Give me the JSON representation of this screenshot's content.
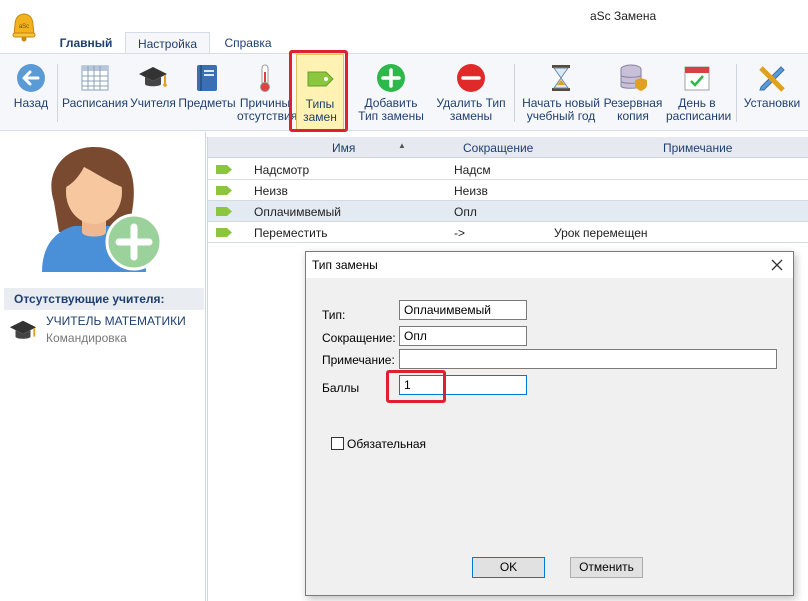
{
  "window": {
    "title": "aSc Замена"
  },
  "tabs": [
    {
      "label": "Главный"
    },
    {
      "label": "Настройка"
    },
    {
      "label": "Справка"
    }
  ],
  "toolbar": [
    {
      "label": "Назад",
      "icon": "back-arrow-icon"
    },
    {
      "label": "Расписания",
      "icon": "timetable-grid-icon"
    },
    {
      "label": "Учителя",
      "icon": "graduation-cap-icon"
    },
    {
      "label": "Предметы",
      "icon": "book-icon"
    },
    {
      "label": "Причины\nотсутствия",
      "icon": "thermometer-icon"
    },
    {
      "label": "Типы\nзамен",
      "icon": "tag-icon"
    },
    {
      "label": "Добавить\nТип замены",
      "icon": "plus-circle-icon"
    },
    {
      "label": "Удалить Тип\nзамены",
      "icon": "minus-circle-icon"
    },
    {
      "label": "Начать новый\nучебный год",
      "icon": "hourglass-icon"
    },
    {
      "label": "Резервная\nкопия",
      "icon": "database-shield-icon"
    },
    {
      "label": "День в\nрасписании",
      "icon": "calendar-check-icon"
    },
    {
      "label": "Установки",
      "icon": "pencil-ruler-icon"
    }
  ],
  "left_panel": {
    "absent_header": "Отсутствующие учителя:",
    "teachers": [
      {
        "name": "УЧИТЕЛЬ МАТЕМАТИКИ",
        "reason": "Командировка"
      }
    ]
  },
  "grid": {
    "columns": [
      "Имя",
      "Сокращение",
      "Примечание"
    ],
    "rows": [
      {
        "name": "Надсмотр",
        "short": "Надсм",
        "note": ""
      },
      {
        "name": "Неизв",
        "short": "Неизв",
        "note": ""
      },
      {
        "name": "Оплачимвемый",
        "short": "Опл",
        "note": ""
      },
      {
        "name": "Переместить",
        "short": "->",
        "note": "Урок перемещен"
      }
    ]
  },
  "dialog": {
    "title": "Тип замены",
    "type_label": "Тип:",
    "type_value": "Оплачимвемый",
    "short_label": "Сокращение:",
    "short_value": "Опл",
    "note_label": "Примечание:",
    "note_value": "",
    "points_label": "Баллы",
    "points_value": "1",
    "mandatory_label": "Обязательная",
    "ok_label": "OK",
    "cancel_label": "Отменить"
  },
  "colors": {
    "accent": "#1f3f6f",
    "highlight": "#e02030",
    "selected_button": "#fff2b3"
  }
}
